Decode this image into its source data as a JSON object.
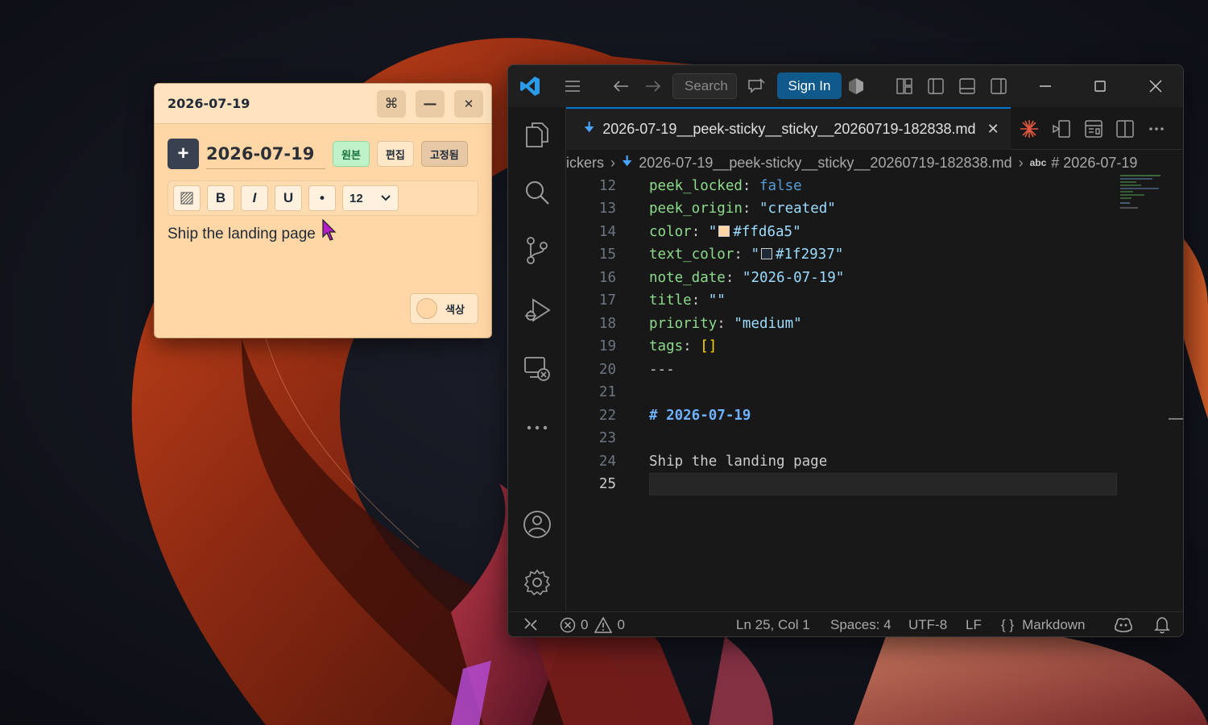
{
  "colors": {
    "sticky_bg": "#ffd6a5",
    "sticky_text": "#1f2937",
    "vscode_accent": "#0078d4",
    "signin_bg": "#0f5a8a"
  },
  "sticky": {
    "window_title": "2026-07-19",
    "titlebar_buttons": [
      "command-icon",
      "minimize-icon",
      "close-icon"
    ],
    "titlebar_glyphs": {
      "command": "⌘",
      "minimize": "—",
      "close": "✕"
    },
    "add_label": "+",
    "date_value": "2026-07-19",
    "mode_original": "원본",
    "mode_edit": "편집",
    "mode_pinned": "고정됨",
    "toolbar": {
      "bold": "B",
      "italic": "I",
      "underline": "U",
      "bullet": "•",
      "font_size": "12"
    },
    "content": "Ship the landing page",
    "color_label": "색상"
  },
  "vscode": {
    "search_placeholder": "Search",
    "signin_label": "Sign In",
    "tab": {
      "filename": "2026-07-19__peek-sticky__sticky__20260719-182838.md",
      "close": "✕"
    },
    "breadcrumb": {
      "folder": "ickers",
      "file": "2026-07-19__peek-sticky__sticky__20260719-182838.md",
      "symbol_prefix": "abc",
      "symbol": "# 2026-07-19"
    },
    "lines": [
      {
        "n": "12",
        "key": "peek_locked",
        "val": "false"
      },
      {
        "n": "13",
        "key": "peek_origin",
        "val": "\"created\""
      },
      {
        "n": "14",
        "key": "color",
        "val": "#ffd6a5"
      },
      {
        "n": "15",
        "key": "text_color",
        "val": "#1f2937"
      },
      {
        "n": "16",
        "key": "note_date",
        "val": "\"2026-07-19\""
      },
      {
        "n": "17",
        "key": "title",
        "val": "\"\""
      },
      {
        "n": "18",
        "key": "priority",
        "val": "\"medium\""
      },
      {
        "n": "19",
        "key": "tags",
        "val": "[]"
      },
      {
        "n": "20",
        "text": "---"
      },
      {
        "n": "21",
        "text": ""
      },
      {
        "n": "22",
        "text": "# 2026-07-19"
      },
      {
        "n": "23",
        "text": ""
      },
      {
        "n": "24",
        "text": "Ship the landing page"
      },
      {
        "n": "25",
        "text": ""
      }
    ],
    "status": {
      "errors": "0",
      "warnings": "0",
      "position": "Ln 25, Col 1",
      "spaces": "Spaces: 4",
      "encoding": "UTF-8",
      "eol": "LF",
      "language": "Markdown"
    }
  }
}
